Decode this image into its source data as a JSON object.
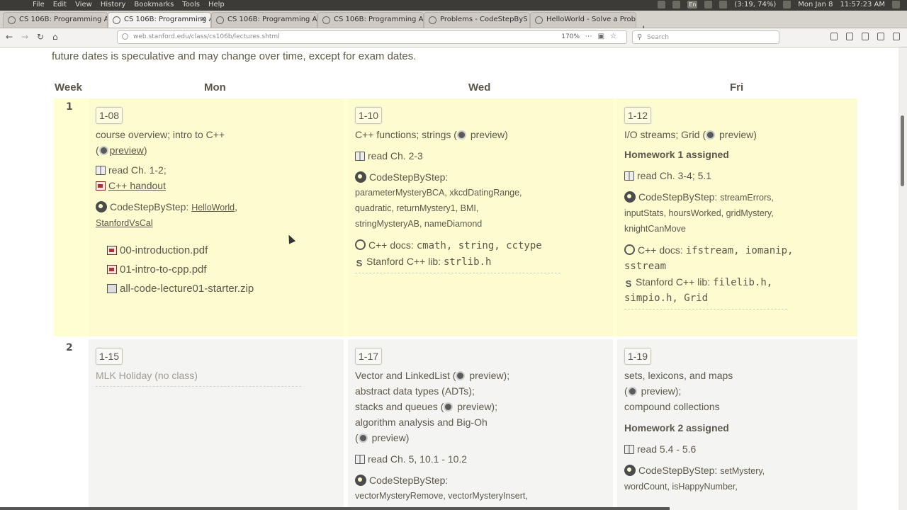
{
  "os": {
    "menus": [
      "File",
      "Edit",
      "View",
      "History",
      "Bookmarks",
      "Tools",
      "Help"
    ],
    "input_method": "En",
    "battery": "(3:19, 74%)",
    "date": "Mon Jan 8",
    "time": "11:57:23 AM"
  },
  "tabs": [
    {
      "label": "CS 106B: Programming A"
    },
    {
      "label": "CS 106B: Programming A"
    },
    {
      "label": "CS 106B: Programming A"
    },
    {
      "label": "CS 106B: Programming A"
    },
    {
      "label": "Problems - CodeStepByS"
    },
    {
      "label": "HelloWorld - Solve a Prob"
    }
  ],
  "address": {
    "url": "web.stanford.edu/class/cs106b/lectures.shtml",
    "zoom": "170%",
    "search_placeholder": "Search"
  },
  "page": {
    "intro": "future dates is speculative and may change over time, except for exam dates.",
    "headers": {
      "week": "Week",
      "mon": "Mon",
      "wed": "Wed",
      "fri": "Fri"
    },
    "week1": {
      "num": "1",
      "mon": {
        "date": "1-08",
        "title": "course overview; intro to C++",
        "preview": "preview",
        "read": "read Ch. 1-2;",
        "handout": "C++ handout",
        "csbs": "CodeStepByStep:",
        "csbs_1": "HelloWorld",
        "csbs_2": "StanfordVsCal",
        "file1": "00-introduction.pdf",
        "file2": "01-intro-to-cpp.pdf",
        "file3": "all-code-lecture01-starter.zip"
      },
      "wed": {
        "date": "1-10",
        "title": "C++ functions; strings (",
        "preview": "preview)",
        "read": "read Ch. 2-3",
        "csbs": "CodeStepByStep:",
        "csbs_list1": "parameterMysteryBCA, xkcdDatingRange,",
        "csbs_list2": "quadratic, returnMystery1, BMI,",
        "csbs_list3": "stringMysteryAB, nameDiamond",
        "docs": "C++ docs:",
        "docs_list": "cmath, string, cctype",
        "lib": "Stanford C++ lib:",
        "lib_list": "strlib.h"
      },
      "fri": {
        "date": "1-12",
        "title": "I/O streams; Grid (",
        "preview": "preview)",
        "assigned": "Homework 1 assigned",
        "read": "read Ch. 3-4; 5.1",
        "csbs": "CodeStepByStep:",
        "csbs_1": "streamErrors,",
        "csbs_list2": "inputStats, hoursWorked, gridMystery,",
        "csbs_list3": "knightCanMove",
        "docs": "C++ docs:",
        "docs_list1": "ifstream, iomanip,",
        "docs_list2": "sstream",
        "lib": "Stanford C++ lib:",
        "lib_list1": "filelib.h,",
        "lib_list2": "simpio.h, Grid"
      }
    },
    "week2": {
      "num": "2",
      "mon": {
        "date": "1-15",
        "title": "MLK Holiday (no class)"
      },
      "wed": {
        "date": "1-17",
        "l1a": "Vector and LinkedList (",
        "l1b": "preview);",
        "l2": "abstract data types (ADTs);",
        "l3a": "stacks and queues (",
        "l3b": "preview);",
        "l4": "algorithm analysis and Big-Oh",
        "l5": "preview)",
        "read": "read Ch. 5, 10.1 - 10.2",
        "csbs": "CodeStepByStep:",
        "csbs_list": "vectorMysteryRemove, vectorMysteryInsert,"
      },
      "fri": {
        "date": "1-19",
        "l1": "sets, lexicons, and maps",
        "l2": "preview);",
        "l3": "compound collections",
        "assigned": "Homework 2 assigned",
        "read": "read 5.4 - 5.6",
        "csbs": "CodeStepByStep:",
        "csbs_1": "setMystery,",
        "csbs_list2": "wordCount, isHappyNumber,"
      }
    }
  }
}
